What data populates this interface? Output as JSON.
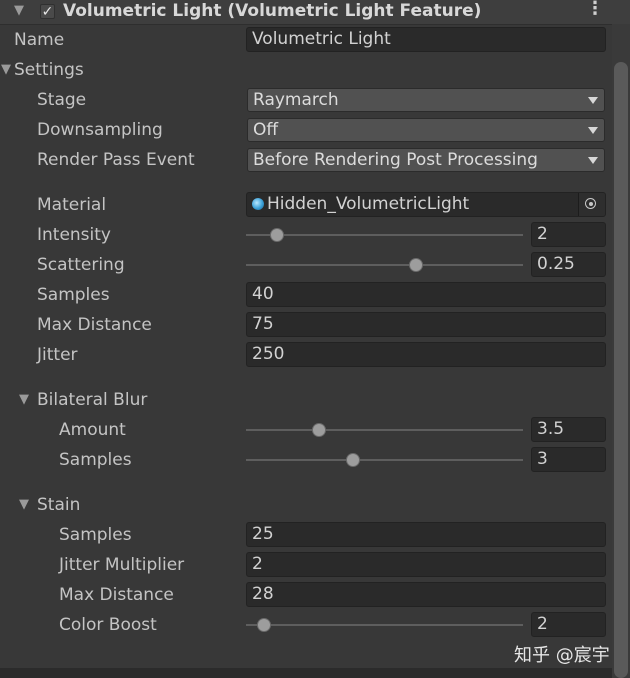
{
  "header": {
    "title": "Volumetric Light (Volumetric Light Feature)",
    "enabled": true,
    "fold_icon": "triangle-down-icon",
    "menu_icon": "kebab-menu-icon"
  },
  "name_row": {
    "label": "Name",
    "value": "Volumetric Light"
  },
  "settings": {
    "label": "Settings",
    "stage": {
      "label": "Stage",
      "value": "Raymarch"
    },
    "downsampling": {
      "label": "Downsampling",
      "value": "Off"
    },
    "render_pass_event": {
      "label": "Render Pass Event",
      "value": "Before Rendering Post Processing"
    },
    "material": {
      "label": "Material",
      "value": "Hidden_VolumetricLight",
      "icon": "material-sphere-icon"
    },
    "intensity": {
      "label": "Intensity",
      "value": "2",
      "slider_fraction": 0.09
    },
    "scattering": {
      "label": "Scattering",
      "value": "0.25",
      "slider_fraction": 0.62
    },
    "samples": {
      "label": "Samples",
      "value": "40"
    },
    "max_distance": {
      "label": "Max Distance",
      "value": "75"
    },
    "jitter": {
      "label": "Jitter",
      "value": "250"
    }
  },
  "bilateral_blur": {
    "label": "Bilateral Blur",
    "amount": {
      "label": "Amount",
      "value": "3.5",
      "slider_fraction": 0.25
    },
    "samples": {
      "label": "Samples",
      "value": "3",
      "slider_fraction": 0.38
    }
  },
  "stain": {
    "label": "Stain",
    "samples": {
      "label": "Samples",
      "value": "25"
    },
    "jitter_multiplier": {
      "label": "Jitter Multiplier",
      "value": "2"
    },
    "max_distance": {
      "label": "Max Distance",
      "value": "28"
    },
    "color_boost": {
      "label": "Color Boost",
      "value": "2",
      "slider_fraction": 0.04
    }
  },
  "watermark": "知乎 @宸宇"
}
